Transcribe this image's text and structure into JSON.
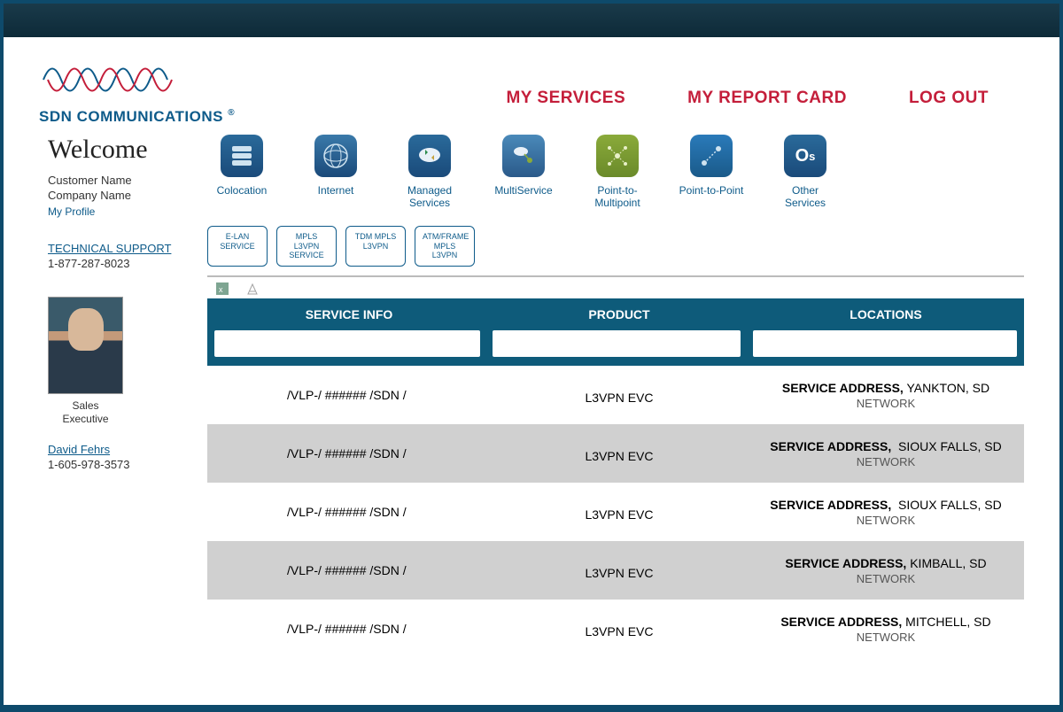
{
  "brand": {
    "name": "SDN COMMUNICATIONS",
    "reg": "®"
  },
  "nav": {
    "services": "MY SERVICES",
    "report": "MY REPORT CARD",
    "logout": "LOG OUT"
  },
  "sidebar": {
    "welcome": "Welcome",
    "customer": "Customer Name",
    "company": "Company Name",
    "profile": "My Profile",
    "tech_label": "TECHNICAL SUPPORT",
    "tech_phone": "1-877-287-8023",
    "role1": "Sales",
    "role2": "Executive",
    "rep_name": "David Fehrs",
    "rep_phone": "1-605-978-3573"
  },
  "svc_icons": [
    {
      "label": "Colocation"
    },
    {
      "label": "Internet"
    },
    {
      "label": "Managed Services"
    },
    {
      "label": "MultiService"
    },
    {
      "label": "Point-to-Multipoint"
    },
    {
      "label": "Point-to-Point"
    },
    {
      "label": "Other Services"
    }
  ],
  "filters": [
    "E-LAN SERVICE",
    "MPLS L3VPN SERVICE",
    "TDM MPLS L3VPN",
    "ATM/FRAME MPLS L3VPN"
  ],
  "table": {
    "h1": "SERVICE INFO",
    "h2": "PRODUCT",
    "h3": "LOCATIONS",
    "rows": [
      {
        "info": "/VLP-/  ######  /SDN /",
        "product": "L3VPN EVC",
        "addr_label": "SERVICE ADDRESS,",
        "city": "YANKTON, SD",
        "net": "NETWORK"
      },
      {
        "info": "/VLP-/  ######  /SDN /",
        "product": "L3VPN EVC",
        "addr_label": "SERVICE ADDRESS,",
        "city": "SIOUX FALLS, SD",
        "net": "NETWORK"
      },
      {
        "info": "/VLP-/  ######  /SDN /",
        "product": "L3VPN EVC",
        "addr_label": "SERVICE ADDRESS,",
        "city": "SIOUX FALLS, SD",
        "net": "NETWORK"
      },
      {
        "info": "/VLP-/  ######  /SDN /",
        "product": "L3VPN EVC",
        "addr_label": "SERVICE ADDRESS,",
        "city": "KIMBALL, SD",
        "net": "NETWORK"
      },
      {
        "info": "/VLP-/  ######  /SDN /",
        "product": "L3VPN EVC",
        "addr_label": "SERVICE ADDRESS,",
        "city": "MITCHELL, SD",
        "net": "NETWORK"
      }
    ]
  }
}
